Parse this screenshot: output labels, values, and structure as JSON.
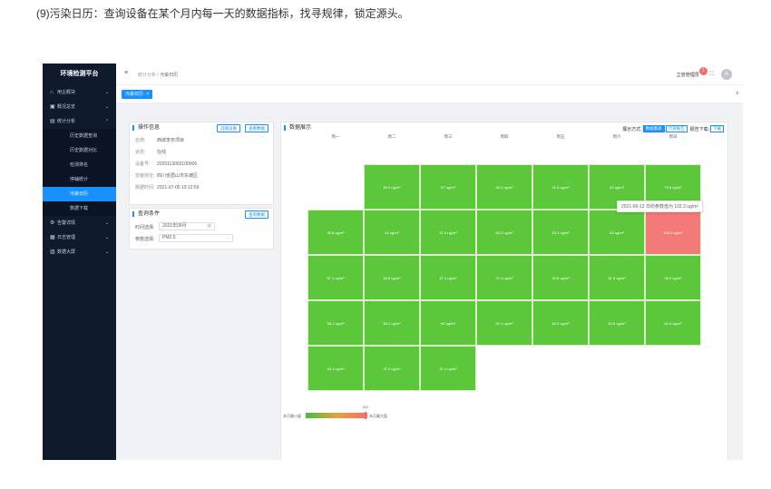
{
  "caption": "(9)污染日历：查询设备在某个月内每一天的数据指标，找寻规律，锁定源头。",
  "sidebar": {
    "brand": "环境检测平台",
    "menu": [
      {
        "icon": "⌂",
        "label": "用尘概块",
        "chev": "⌄"
      },
      {
        "icon": "▣",
        "label": "概况总览",
        "chev": "⌄"
      },
      {
        "icon": "▤",
        "label": "统计分析",
        "chev": "⌃"
      }
    ],
    "sub": [
      "历史数据查询",
      "历史数据对比",
      "检测排名",
      "停辅统计",
      "污染日历",
      "数据下载"
    ],
    "active_sub": 4,
    "menu2": [
      {
        "icon": "⚙",
        "label": "告警详情",
        "chev": "⌄"
      },
      {
        "icon": "▦",
        "label": "日志管理",
        "chev": "⌄"
      },
      {
        "icon": "▥",
        "label": "数据大屏",
        "chev": "⌄"
      }
    ]
  },
  "header": {
    "hamburger_icon": "≡",
    "breadcrumb_parent": "统计分析",
    "breadcrumb_sep": "/",
    "breadcrumb_current": "污染日历",
    "admin": "立容管理员",
    "badge": "1",
    "fullscreen_icon": "⛶",
    "avatar": "A"
  },
  "tags": {
    "active_tag": "污染日历",
    "close": "×",
    "chevron": "∨"
  },
  "op_info": {
    "title": "操作信息",
    "btn_select": "选择设备",
    "btn_view": "查看数据",
    "rows": [
      {
        "k": "名称:",
        "v": "西城李务项目"
      },
      {
        "k": "状态:",
        "v": "在线"
      },
      {
        "k": "设备号:",
        "v": "2020113003100006"
      },
      {
        "k": "安装地址:",
        "v": "四川省眉山市东坡区"
      },
      {
        "k": "数据时间:",
        "v": "2021-07-05 10:12:59"
      }
    ]
  },
  "query": {
    "title": "查询条件",
    "btn_query": "查询数据",
    "time_label": "时间选择:",
    "time_value": "2021年06月",
    "param_label": "参数选择:",
    "param_value": "PM2.5",
    "calendar_icon": "▦",
    "dropdown_icon": "⌄"
  },
  "display": {
    "title": "数据展示",
    "mode_label": "展示方式:",
    "mode_active": "数据图表",
    "mode_other": "污染报告",
    "report_label": "报告下载:",
    "report_btn": "下载"
  },
  "chart_data": {
    "type": "heatmap",
    "weekdays": [
      "周一",
      "周二",
      "周三",
      "周四",
      "周五",
      "周六",
      "周日"
    ],
    "unit": "ug/m³",
    "weeks": [
      [
        null,
        "50.0",
        "57",
        "26.2",
        "31.6",
        "42",
        "75.5"
      ],
      [
        "95.8",
        "44",
        "57.4",
        "64.3",
        "53.1",
        "83",
        "102.3"
      ],
      [
        "97.1",
        "53.6",
        "47.4",
        "27.4",
        "34.8",
        "61.5",
        "46.9"
      ],
      [
        "58.1",
        "86.2",
        "82",
        "92.1",
        "60.2",
        "63.8",
        "62.6"
      ],
      [
        "49.1",
        "37.2",
        "37.4",
        null,
        null,
        null,
        null
      ]
    ],
    "highlight": {
      "week": 1,
      "day": 6
    },
    "tooltip": "2021-06-13 日的参数值为 102.3 ug/m³",
    "scale_min_label": "本月最小值",
    "scale_max_label": "本月最大值",
    "scale_max_value": "102",
    "colors": {
      "normal": "#5cc73b",
      "high": "#f47a7a"
    }
  }
}
